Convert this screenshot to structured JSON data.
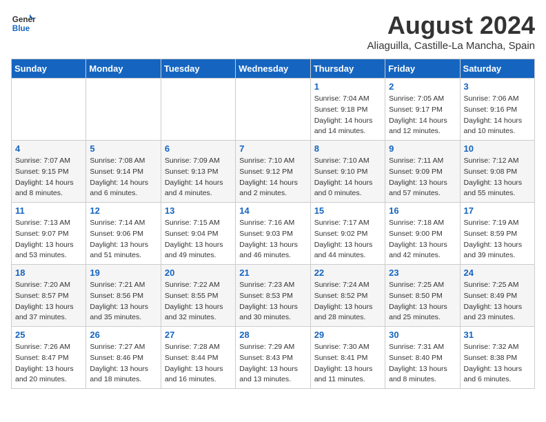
{
  "logo": {
    "line1": "General",
    "line2": "Blue"
  },
  "title": "August 2024",
  "subtitle": "Aliaguilla, Castille-La Mancha, Spain",
  "days_of_week": [
    "Sunday",
    "Monday",
    "Tuesday",
    "Wednesday",
    "Thursday",
    "Friday",
    "Saturday"
  ],
  "weeks": [
    [
      {
        "day": "",
        "info": ""
      },
      {
        "day": "",
        "info": ""
      },
      {
        "day": "",
        "info": ""
      },
      {
        "day": "",
        "info": ""
      },
      {
        "day": "1",
        "info": "Sunrise: 7:04 AM\nSunset: 9:18 PM\nDaylight: 14 hours\nand 14 minutes."
      },
      {
        "day": "2",
        "info": "Sunrise: 7:05 AM\nSunset: 9:17 PM\nDaylight: 14 hours\nand 12 minutes."
      },
      {
        "day": "3",
        "info": "Sunrise: 7:06 AM\nSunset: 9:16 PM\nDaylight: 14 hours\nand 10 minutes."
      }
    ],
    [
      {
        "day": "4",
        "info": "Sunrise: 7:07 AM\nSunset: 9:15 PM\nDaylight: 14 hours\nand 8 minutes."
      },
      {
        "day": "5",
        "info": "Sunrise: 7:08 AM\nSunset: 9:14 PM\nDaylight: 14 hours\nand 6 minutes."
      },
      {
        "day": "6",
        "info": "Sunrise: 7:09 AM\nSunset: 9:13 PM\nDaylight: 14 hours\nand 4 minutes."
      },
      {
        "day": "7",
        "info": "Sunrise: 7:10 AM\nSunset: 9:12 PM\nDaylight: 14 hours\nand 2 minutes."
      },
      {
        "day": "8",
        "info": "Sunrise: 7:10 AM\nSunset: 9:10 PM\nDaylight: 14 hours\nand 0 minutes."
      },
      {
        "day": "9",
        "info": "Sunrise: 7:11 AM\nSunset: 9:09 PM\nDaylight: 13 hours\nand 57 minutes."
      },
      {
        "day": "10",
        "info": "Sunrise: 7:12 AM\nSunset: 9:08 PM\nDaylight: 13 hours\nand 55 minutes."
      }
    ],
    [
      {
        "day": "11",
        "info": "Sunrise: 7:13 AM\nSunset: 9:07 PM\nDaylight: 13 hours\nand 53 minutes."
      },
      {
        "day": "12",
        "info": "Sunrise: 7:14 AM\nSunset: 9:06 PM\nDaylight: 13 hours\nand 51 minutes."
      },
      {
        "day": "13",
        "info": "Sunrise: 7:15 AM\nSunset: 9:04 PM\nDaylight: 13 hours\nand 49 minutes."
      },
      {
        "day": "14",
        "info": "Sunrise: 7:16 AM\nSunset: 9:03 PM\nDaylight: 13 hours\nand 46 minutes."
      },
      {
        "day": "15",
        "info": "Sunrise: 7:17 AM\nSunset: 9:02 PM\nDaylight: 13 hours\nand 44 minutes."
      },
      {
        "day": "16",
        "info": "Sunrise: 7:18 AM\nSunset: 9:00 PM\nDaylight: 13 hours\nand 42 minutes."
      },
      {
        "day": "17",
        "info": "Sunrise: 7:19 AM\nSunset: 8:59 PM\nDaylight: 13 hours\nand 39 minutes."
      }
    ],
    [
      {
        "day": "18",
        "info": "Sunrise: 7:20 AM\nSunset: 8:57 PM\nDaylight: 13 hours\nand 37 minutes."
      },
      {
        "day": "19",
        "info": "Sunrise: 7:21 AM\nSunset: 8:56 PM\nDaylight: 13 hours\nand 35 minutes."
      },
      {
        "day": "20",
        "info": "Sunrise: 7:22 AM\nSunset: 8:55 PM\nDaylight: 13 hours\nand 32 minutes."
      },
      {
        "day": "21",
        "info": "Sunrise: 7:23 AM\nSunset: 8:53 PM\nDaylight: 13 hours\nand 30 minutes."
      },
      {
        "day": "22",
        "info": "Sunrise: 7:24 AM\nSunset: 8:52 PM\nDaylight: 13 hours\nand 28 minutes."
      },
      {
        "day": "23",
        "info": "Sunrise: 7:25 AM\nSunset: 8:50 PM\nDaylight: 13 hours\nand 25 minutes."
      },
      {
        "day": "24",
        "info": "Sunrise: 7:25 AM\nSunset: 8:49 PM\nDaylight: 13 hours\nand 23 minutes."
      }
    ],
    [
      {
        "day": "25",
        "info": "Sunrise: 7:26 AM\nSunset: 8:47 PM\nDaylight: 13 hours\nand 20 minutes."
      },
      {
        "day": "26",
        "info": "Sunrise: 7:27 AM\nSunset: 8:46 PM\nDaylight: 13 hours\nand 18 minutes."
      },
      {
        "day": "27",
        "info": "Sunrise: 7:28 AM\nSunset: 8:44 PM\nDaylight: 13 hours\nand 16 minutes."
      },
      {
        "day": "28",
        "info": "Sunrise: 7:29 AM\nSunset: 8:43 PM\nDaylight: 13 hours\nand 13 minutes."
      },
      {
        "day": "29",
        "info": "Sunrise: 7:30 AM\nSunset: 8:41 PM\nDaylight: 13 hours\nand 11 minutes."
      },
      {
        "day": "30",
        "info": "Sunrise: 7:31 AM\nSunset: 8:40 PM\nDaylight: 13 hours\nand 8 minutes."
      },
      {
        "day": "31",
        "info": "Sunrise: 7:32 AM\nSunset: 8:38 PM\nDaylight: 13 hours\nand 6 minutes."
      }
    ]
  ]
}
